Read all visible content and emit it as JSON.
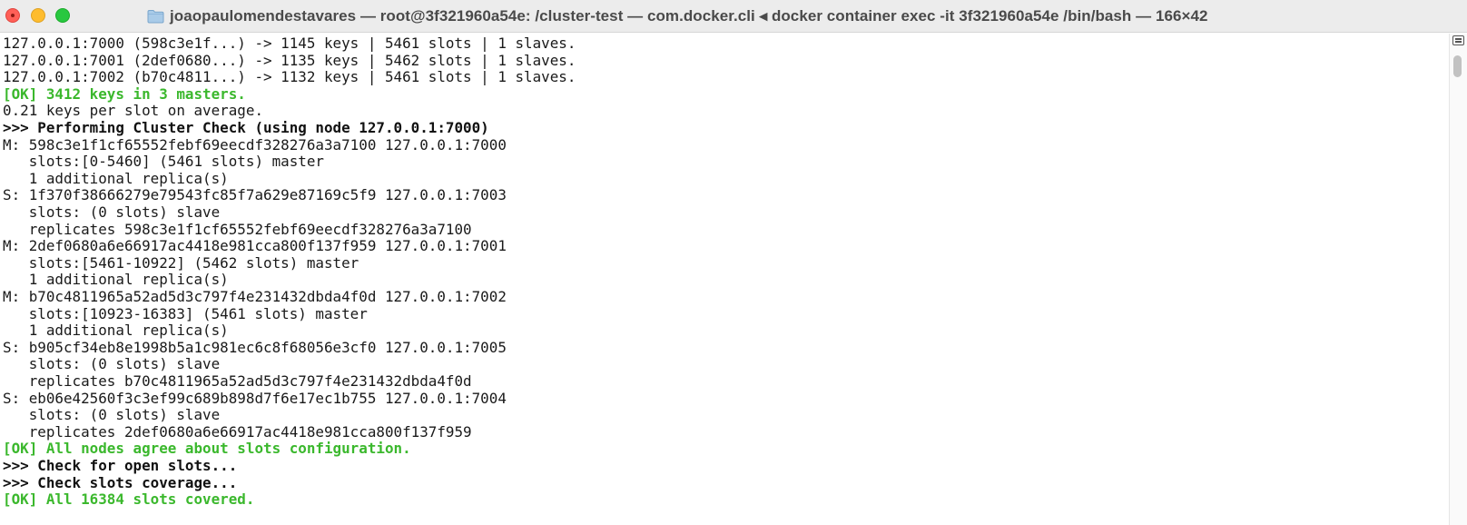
{
  "window": {
    "title": "joaopaulomendestavares — root@3f321960a54e: /cluster-test — com.docker.cli ◂ docker container exec -it 3f321960a54e /bin/bash — 166×42",
    "colors": {
      "ok_green": "#3bb82d",
      "close": "#ff5f57",
      "minimize": "#febc2e",
      "maximize": "#28c840"
    }
  },
  "terminal": {
    "lines": [
      {
        "text": "127.0.0.1:7000 (598c3e1f...) -> 1145 keys | 5461 slots | 1 slaves.",
        "style": "normal"
      },
      {
        "text": "127.0.0.1:7001 (2def0680...) -> 1135 keys | 5462 slots | 1 slaves.",
        "style": "normal"
      },
      {
        "text": "127.0.0.1:7002 (b70c4811...) -> 1132 keys | 5461 slots | 1 slaves.",
        "style": "normal"
      },
      {
        "text": "[OK] 3412 keys in 3 masters.",
        "style": "ok"
      },
      {
        "text": "0.21 keys per slot on average.",
        "style": "normal"
      },
      {
        "text": ">>> Performing Cluster Check (using node 127.0.0.1:7000)",
        "style": "bold"
      },
      {
        "text": "M: 598c3e1f1cf65552febf69eecdf328276a3a7100 127.0.0.1:7000",
        "style": "normal"
      },
      {
        "text": "   slots:[0-5460] (5461 slots) master",
        "style": "normal"
      },
      {
        "text": "   1 additional replica(s)",
        "style": "normal"
      },
      {
        "text": "S: 1f370f38666279e79543fc85f7a629e87169c5f9 127.0.0.1:7003",
        "style": "normal"
      },
      {
        "text": "   slots: (0 slots) slave",
        "style": "normal"
      },
      {
        "text": "   replicates 598c3e1f1cf65552febf69eecdf328276a3a7100",
        "style": "normal"
      },
      {
        "text": "M: 2def0680a6e66917ac4418e981cca800f137f959 127.0.0.1:7001",
        "style": "normal"
      },
      {
        "text": "   slots:[5461-10922] (5462 slots) master",
        "style": "normal"
      },
      {
        "text": "   1 additional replica(s)",
        "style": "normal"
      },
      {
        "text": "M: b70c4811965a52ad5d3c797f4e231432dbda4f0d 127.0.0.1:7002",
        "style": "normal"
      },
      {
        "text": "   slots:[10923-16383] (5461 slots) master",
        "style": "normal"
      },
      {
        "text": "   1 additional replica(s)",
        "style": "normal"
      },
      {
        "text": "S: b905cf34eb8e1998b5a1c981ec6c8f68056e3cf0 127.0.0.1:7005",
        "style": "normal"
      },
      {
        "text": "   slots: (0 slots) slave",
        "style": "normal"
      },
      {
        "text": "   replicates b70c4811965a52ad5d3c797f4e231432dbda4f0d",
        "style": "normal"
      },
      {
        "text": "S: eb06e42560f3c3ef99c689b898d7f6e17ec1b755 127.0.0.1:7004",
        "style": "normal"
      },
      {
        "text": "   slots: (0 slots) slave",
        "style": "normal"
      },
      {
        "text": "   replicates 2def0680a6e66917ac4418e981cca800f137f959",
        "style": "normal"
      },
      {
        "text": "[OK] All nodes agree about slots configuration.",
        "style": "ok"
      },
      {
        "text": ">>> Check for open slots...",
        "style": "bold"
      },
      {
        "text": ">>> Check slots coverage...",
        "style": "bold"
      },
      {
        "text": "[OK] All 16384 slots covered.",
        "style": "ok"
      }
    ]
  },
  "icons": {
    "close": "close-button-icon",
    "minimize": "minimize-button-icon",
    "maximize": "maximize-button-icon",
    "folder": "folder-icon",
    "scroll_menu": "scroll-menu-icon"
  }
}
